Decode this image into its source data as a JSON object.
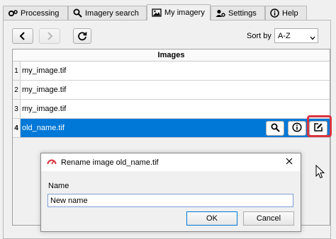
{
  "tabs": [
    {
      "label": "Processing",
      "icon": "gears-icon",
      "active": false
    },
    {
      "label": "Imagery search",
      "icon": "search-icon",
      "active": false
    },
    {
      "label": "My imagery",
      "icon": "image-icon",
      "active": true
    },
    {
      "label": "Settings",
      "icon": "gear-user-icon",
      "active": false
    },
    {
      "label": "Help",
      "icon": "info-icon",
      "active": false
    }
  ],
  "toolbar": {
    "sort_label": "Sort by",
    "sort_value": "A-Z"
  },
  "table": {
    "header": "Images",
    "rows": [
      {
        "num": "1",
        "name": "my_image.tif",
        "selected": false
      },
      {
        "num": "2",
        "name": "my_image.tif",
        "selected": false
      },
      {
        "num": "3",
        "name": "my_image.tif",
        "selected": false
      },
      {
        "num": "4",
        "name": "old_name.tif",
        "selected": true
      }
    ]
  },
  "dialog": {
    "title": "Rename image old_name.tif",
    "field_label": "Name",
    "field_value": "New name",
    "ok_label": "OK",
    "cancel_label": "Cancel"
  },
  "colors": {
    "selection": "#0078d7",
    "highlight": "#d9333f"
  }
}
